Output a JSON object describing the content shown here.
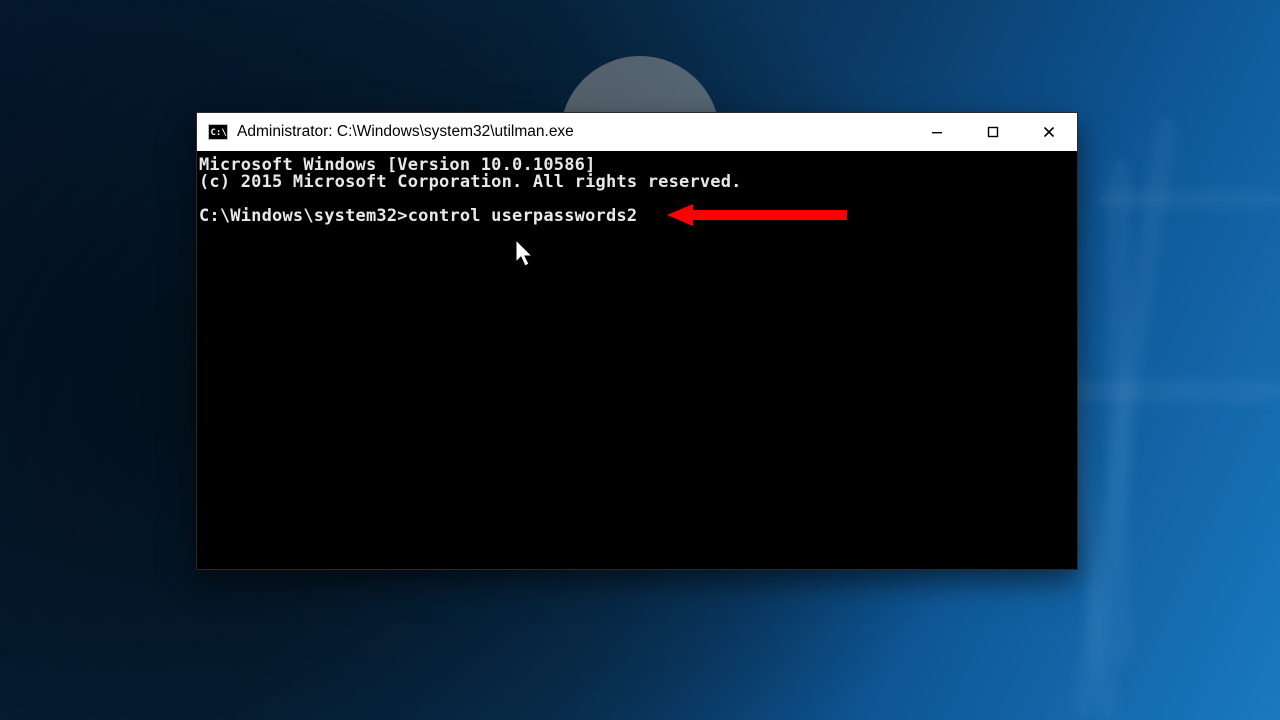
{
  "window": {
    "title": "Administrator: C:\\Windows\\system32\\utilman.exe"
  },
  "terminal": {
    "line1": "Microsoft Windows [Version 10.0.10586]",
    "line2": "(c) 2015 Microsoft Corporation. All rights reserved.",
    "prompt": "C:\\Windows\\system32>",
    "command": "control userpasswords2"
  },
  "annotation": {
    "arrow_color": "#ff0000"
  }
}
